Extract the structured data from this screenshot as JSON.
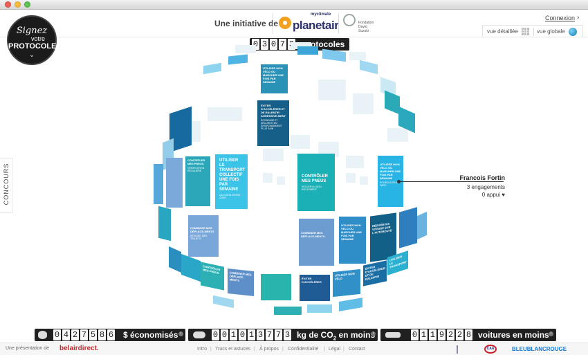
{
  "badge": {
    "line1": "Signez",
    "line2": "votre",
    "line3": "PROTOCOLE",
    "line4": "⌄"
  },
  "header": {
    "initiative": "Une initiative de",
    "planetair_brand": "planetair",
    "planetair_sub": "myclimate",
    "suzuki_lines": [
      "Fondation",
      "David",
      "Suzuki"
    ],
    "connexion": "Connexion",
    "connexion_chevron": "›",
    "view_detailed": "vue détaillée",
    "view_global": "vue globale"
  },
  "top_counter": {
    "digits": [
      "0",
      "3",
      "0",
      "7",
      "3"
    ],
    "label": "protocoles"
  },
  "concours": "CONCOURS",
  "tiles": [
    {
      "text": "UTILISER MON VÉLO OU MARCHER UNE FOIS PAR SEMAINE",
      "sub": "",
      "color": "#2a92b6"
    },
    {
      "text": "ÉVITER D'ACCÉLÉRER ET DE RALENTIR AGRESSIVE-MENT",
      "sub": "ÉCONOMIE ET SÉCURITÉ EN ENVIRONNEMENT PLUS SAIN",
      "color": "#155f89"
    },
    {
      "text": "CONTRÔLER MES PNEUS",
      "sub": "VÉRIFICATION RÉGULIÈRE",
      "color": "#29a9b8"
    },
    {
      "text": "UTILISER LE TRANSPORT COLLECTIF UNE FOIS PAR SEMAINE",
      "sub": "ÇA COÛTE MOINS CHER",
      "color": "#3cc3e8"
    },
    {
      "text": "CONTRÔLER MES PNEUS",
      "sub": "VEILLER AU BON ROULEMENT",
      "color": "#1bb0b5"
    },
    {
      "text": "UTILISER MON VÉLO OU MARCHER UNE FOIS PAR SEMAINE",
      "sub": "POUR ALLER AU PARC",
      "color": "#28b4e4"
    },
    {
      "text": "COMBINER MES DÉPLACE-MENTS",
      "sub": "RÉDUIRE MES TRAJETS",
      "color": "#7aa7d9"
    },
    {
      "text": "UTILISER MON VÉLO OU MARCHER UNE FOIS PAR SEMAINE",
      "sub": "",
      "color": "#2f8dc7"
    },
    {
      "text": "RÉDUIRE MA VITESSE SUR L'AUTOROUTE",
      "sub": "",
      "color": "#125f88"
    },
    {
      "text": "COMBINER MES DÉPLACE-MENTS",
      "sub": "",
      "color": "#6d9dd0"
    },
    {
      "text": "ÉVITER D'ACCÉLÉRER ET DE RALENTIR",
      "sub": "",
      "color": "#1b6ea4"
    },
    {
      "text": "UTILISER MON VÉLO",
      "sub": "",
      "color": "#3190c7"
    },
    {
      "text": "CONTRÔLER MES PNEUS",
      "sub": "",
      "color": "#2cb0b3"
    },
    {
      "text": "COMBINER MES DÉPLACE-MENTS",
      "sub": "",
      "color": "#5f8fc9"
    },
    {
      "text": "ÉVITER D'ACCÉLÉRER",
      "sub": "",
      "color": "#1f5b94"
    },
    {
      "text": "UTILISER LE TRANSPORT",
      "sub": "",
      "color": "#2cb0d0"
    }
  ],
  "callout": {
    "name": "Francois Fortin",
    "engagements": "3 engagements",
    "appuis": "0 appui ♥"
  },
  "stats": {
    "money": {
      "digits": [
        "0",
        "4",
        "2",
        "7",
        "5",
        "8",
        "6"
      ],
      "label": "$ économisés"
    },
    "co2": {
      "digits": [
        "0",
        "0",
        "1",
        "0",
        "1",
        "3",
        "7",
        "7",
        "3"
      ],
      "label_prefix": "kg de CO",
      "label_sub": "2",
      "label_suffix": " en moins"
    },
    "cars": {
      "digits": [
        "0",
        "1",
        "1",
        "9",
        "2",
        "2",
        "8"
      ],
      "label": "voitures en moins"
    }
  },
  "footer": {
    "presentation": "Une présentation de",
    "belair": "belairdirect.",
    "links": [
      "Intro",
      "Trucs et astuces",
      "À propos",
      "Confidentialité",
      "Légal",
      "Contact"
    ],
    "caa": "CAA",
    "bleu": "BLEUBLANCROUGE"
  },
  "colors": {
    "counter_bg": "#202020",
    "accent_blue": "#1a75c9",
    "belair_red": "#c42a30",
    "planetair_orange": "#f2a120"
  }
}
